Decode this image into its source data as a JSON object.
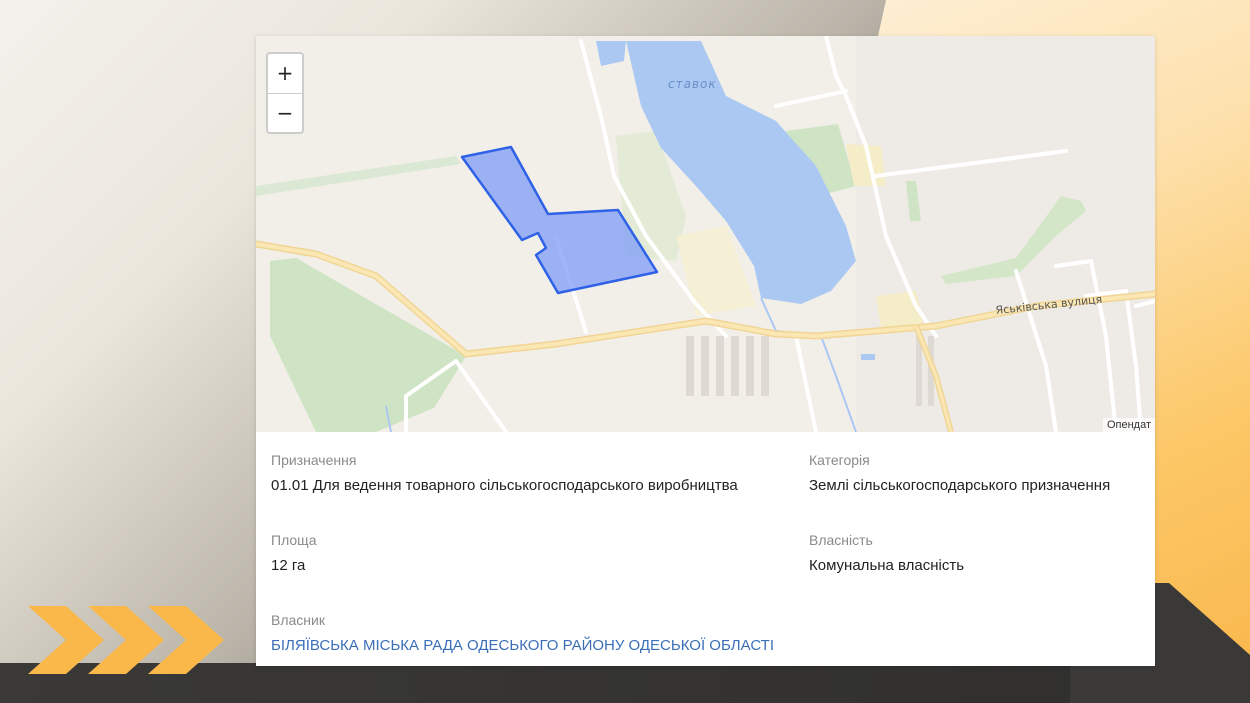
{
  "map": {
    "zoom_in_label": "+",
    "zoom_out_label": "−",
    "attribution": "Опендат",
    "lake_label": "ставок",
    "street_label": "Яськівська вулиця",
    "parcel_color": "#6f8ff5"
  },
  "info": {
    "purpose_label": "Призначення",
    "purpose_value": "01.01 Для ведення товарного сільськогосподарського виробництва",
    "category_label": "Категорія",
    "category_value": "Землі сільськогосподарського призначення",
    "area_label": "Площа",
    "area_value": "12 га",
    "ownership_label": "Власність",
    "ownership_value": "Комунальна власність",
    "owner_label": "Власник",
    "owner_value": "БІЛЯЇВСЬКА МІСЬКА РАДА ОДЕСЬКОГО РАЙОНУ ОДЕСЬКОЇ ОБЛАСТІ"
  },
  "colors": {
    "accent_orange": "#fbb84a",
    "link_blue": "#3a6fb8",
    "water_blue": "#aac8f2"
  }
}
